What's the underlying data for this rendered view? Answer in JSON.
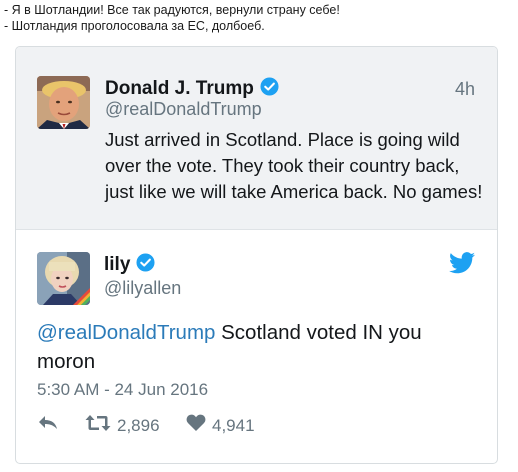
{
  "caption": {
    "line1": "- Я в Шотландии! Все так радуются, вернули страну себе!",
    "line2": "- Шотландия проголосовала за ЕС, долбоеб."
  },
  "quoted_tweet": {
    "name": "Donald J. Trump",
    "handle": "@realDonaldTrump",
    "time": "4h",
    "text": "Just arrived in Scotland. Place is going wild over the vote. They took their country back, just like we will take America back. No games!"
  },
  "main_tweet": {
    "name": "lily",
    "handle": "@lilyallen",
    "mention": "@realDonaldTrump",
    "text": " Scotland voted IN you moron",
    "date": "5:30 AM - 24 Jun 2016",
    "retweets": "2,896",
    "likes": "4,941"
  },
  "icons": {
    "verified": "verified-badge-icon",
    "twitter": "twitter-bird-icon",
    "reply": "reply-icon",
    "retweet": "retweet-icon",
    "like": "heart-icon"
  },
  "colors": {
    "verified_blue": "#1da1f2",
    "mention_blue": "#2b7bb9",
    "muted": "#66757f",
    "quote_bg": "#f0f2f4"
  }
}
